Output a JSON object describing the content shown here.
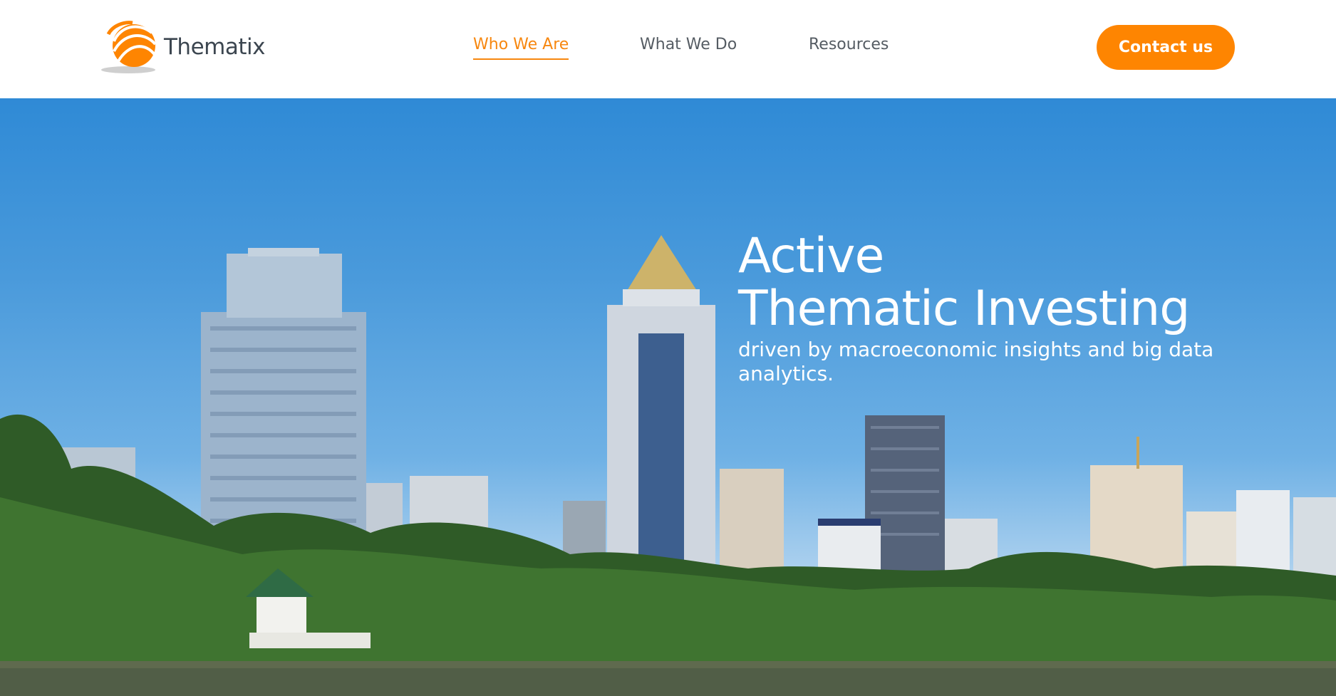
{
  "brand": {
    "name": "Thematix",
    "accent_color": "#fe8501",
    "logo_icon": "orange-sphere-swirl-icon"
  },
  "nav": {
    "items": [
      {
        "label": "Who We Are",
        "active": true
      },
      {
        "label": "What We Do",
        "active": false
      },
      {
        "label": "Resources",
        "active": false
      }
    ]
  },
  "header": {
    "contact_label": "Contact us"
  },
  "hero": {
    "line1": "Active",
    "line2": "Thematic Investing",
    "subtitle": "driven by macroeconomic insights and big data analytics.",
    "image": "city-skyline-over-park-lake"
  }
}
